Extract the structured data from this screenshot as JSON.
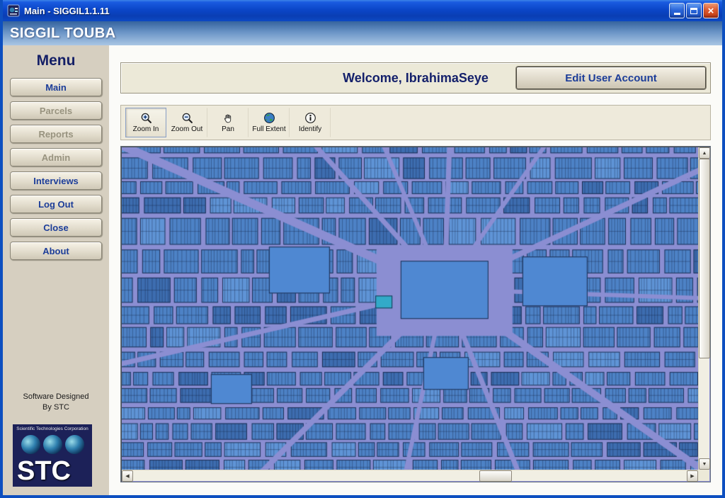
{
  "theme": {
    "frame": "#0d4fc0",
    "accent": "#1c3d99",
    "beige": "#ece9d8",
    "sidebar_beige": "#d6cfc0"
  },
  "window": {
    "title": "Main - SIGGIL1.1.11",
    "close_glyph": "×"
  },
  "banner": {
    "title": "SIGGIL TOUBA"
  },
  "sidebar": {
    "menu_title": "Menu",
    "items": [
      {
        "label": "Main",
        "enabled": true
      },
      {
        "label": "Parcels",
        "enabled": false
      },
      {
        "label": "Reports",
        "enabled": false
      },
      {
        "label": "Admin",
        "enabled": false
      },
      {
        "label": "Interviews",
        "enabled": true
      },
      {
        "label": "Log Out",
        "enabled": true
      },
      {
        "label": "Close",
        "enabled": true
      },
      {
        "label": "About",
        "enabled": true
      }
    ],
    "credit_line1": "Software Designed",
    "credit_line2": "By STC",
    "logo": {
      "caption": "Scientific Technologies Corporation",
      "acronym": "STC"
    }
  },
  "main": {
    "welcome_text": "Welcome, IbrahimaSeye",
    "edit_account_label": "Edit User Account",
    "toolbar": {
      "buttons": [
        {
          "label": "Zoom In"
        },
        {
          "label": "Zoom Out"
        },
        {
          "label": "Pan"
        },
        {
          "label": "Full Extent"
        },
        {
          "label": "Identify"
        }
      ]
    },
    "map": {
      "colors": {
        "street": "#8b8ed2",
        "parcel": "#4d82c6",
        "parcel_dark": "#3d6db0",
        "parcel_light": "#5f94d6",
        "outline": "#101c3a",
        "plaza": "#4f88d2",
        "highlight": "#32aac8"
      }
    }
  }
}
